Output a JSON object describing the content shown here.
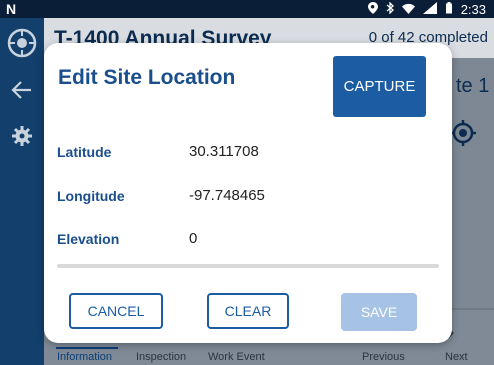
{
  "status_bar": {
    "left_icon": "N",
    "time": "2:33"
  },
  "background": {
    "title": "T-1400 Annual Survey",
    "progress": "0 of 42 completed",
    "site_label_partial": "te 1",
    "bottom_nav": {
      "information": "Information",
      "inspection": "Inspection",
      "work_event": "Work Event",
      "previous": "Previous",
      "next": "Next"
    }
  },
  "dialog": {
    "title": "Edit Site Location",
    "capture_label": "CAPTURE",
    "fields": [
      {
        "label": "Latitude",
        "value": "30.311708"
      },
      {
        "label": "Longitude",
        "value": "-97.748465"
      },
      {
        "label": "Elevation",
        "value": "0"
      }
    ],
    "cancel_label": "CANCEL",
    "clear_label": "CLEAR",
    "save_label": "SAVE",
    "save_enabled": false
  },
  "colors": {
    "primary": "#1b5ca3",
    "label": "#1a4e8c",
    "save_disabled": "#a6c3e6",
    "status_bar": "#0b1e38",
    "rail": "#123f6b"
  }
}
